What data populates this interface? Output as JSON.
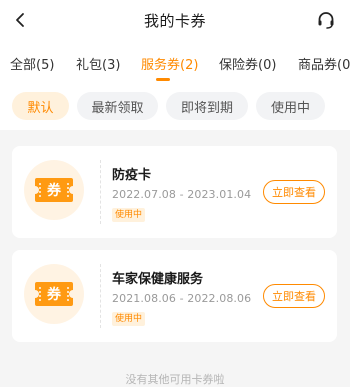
{
  "header": {
    "title": "我的卡券"
  },
  "tabs": [
    {
      "label": "全部(5)"
    },
    {
      "label": "礼包(3)"
    },
    {
      "label": "服务券(2)"
    },
    {
      "label": "保险券(0)"
    },
    {
      "label": "商品券(0)"
    }
  ],
  "active_tab": "服务券(2)",
  "filters": [
    {
      "label": "默认"
    },
    {
      "label": "最新领取"
    },
    {
      "label": "即将到期"
    },
    {
      "label": "使用中"
    }
  ],
  "active_filter": "默认",
  "cards": [
    {
      "icon_label": "券",
      "name": "防疫卡",
      "dates": "2022.07.08 - 2023.01.04",
      "status": "使用中",
      "action": "立即查看"
    },
    {
      "icon_label": "券",
      "name": "车家保健康服务",
      "dates": "2021.08.06 - 2022.08.06",
      "status": "使用中",
      "action": "立即查看"
    }
  ],
  "footer": {
    "note": "没有其他可用卡券啦"
  },
  "colors": {
    "accent": "#ff8a00",
    "accent_light": "#fff1dc",
    "icon_circle": "#fff3e3",
    "background": "#f5f5f5"
  },
  "icons": {
    "back": "back-arrow-icon",
    "support": "headset-icon",
    "coupon": "coupon-icon"
  }
}
